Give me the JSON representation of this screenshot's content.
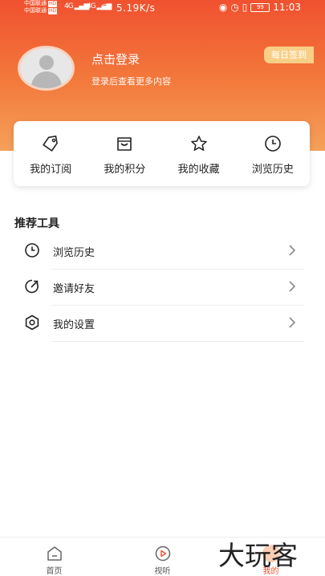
{
  "status_bar": {
    "carrier1": "中国联通",
    "carrier2": "中国联通",
    "hd_tag": "HD",
    "signal1": "4G",
    "signal2": "4G",
    "speed": "5.19K/s",
    "battery": "99",
    "time": "11:03"
  },
  "profile": {
    "login_title": "点击登录",
    "login_sub": "登录后查看更多内容",
    "checkin_label": "每日签到"
  },
  "quick_actions": [
    {
      "label": "我的订阅",
      "icon": "tag-icon"
    },
    {
      "label": "我的积分",
      "icon": "bag-icon"
    },
    {
      "label": "我的收藏",
      "icon": "star-icon"
    },
    {
      "label": "浏览历史",
      "icon": "clock-icon"
    }
  ],
  "tools": {
    "title": "推荐工具",
    "items": [
      {
        "label": "浏览历史",
        "icon": "clock-icon"
      },
      {
        "label": "邀请好友",
        "icon": "share-icon"
      },
      {
        "label": "我的设置",
        "icon": "settings-icon"
      }
    ]
  },
  "bottom_nav": [
    {
      "label": "首页",
      "icon": "home-icon",
      "active": false
    },
    {
      "label": "视听",
      "icon": "play-icon",
      "active": false
    },
    {
      "label": "我的",
      "icon": "profile-icon",
      "active": true
    }
  ],
  "watermark": "大玩客",
  "colors": {
    "accent": "#f0512f",
    "header_gradient_end": "#f4a15a",
    "checkin_bg": "#f8cf86"
  }
}
